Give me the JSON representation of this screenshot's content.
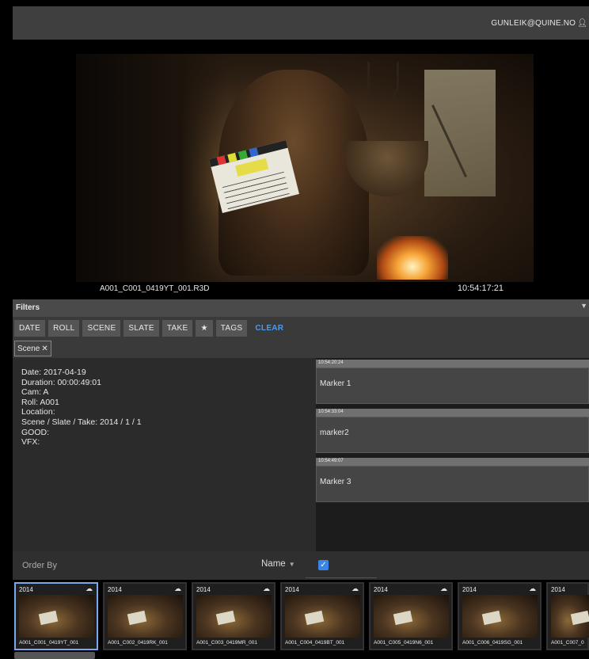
{
  "header": {
    "user": "GUNLEIK@QUINE.NO",
    "user_icon": "user-icon"
  },
  "player": {
    "clip_name": "A001_C001_0419YT_001.R3D",
    "timecode": "10:54:17:21"
  },
  "filters": {
    "title": "Filters",
    "buttons": [
      "DATE",
      "ROLL",
      "SCENE",
      "SLATE",
      "TAKE",
      "★",
      "TAGS"
    ],
    "clear_label": "CLEAR",
    "active_chip": "Scene",
    "chip_close": "✕"
  },
  "metadata": {
    "lines": [
      "Date: 2017-04-19",
      "Duration: 00:00:49:01",
      "Cam: A",
      "Roll: A001",
      "Location:",
      "Scene / Slate / Take: 2014 / 1 / 1",
      "GOOD:",
      "VFX:"
    ]
  },
  "markers": [
    {
      "time": "10:54:20:24",
      "label": "Marker 1"
    },
    {
      "time": "10:54:33:04",
      "label": "marker2"
    },
    {
      "time": "10:54:49:07",
      "label": "Marker 3"
    }
  ],
  "order": {
    "label": "Order By",
    "value": "Name",
    "checked": true
  },
  "thumbnails": [
    {
      "year": "2014",
      "name": "A001_C001_0419YT_001",
      "selected": true
    },
    {
      "year": "2014",
      "name": "A001_C002_0419RK_001",
      "selected": false
    },
    {
      "year": "2014",
      "name": "A001_C003_0419MR_001",
      "selected": false
    },
    {
      "year": "2014",
      "name": "A001_C004_0419BT_001",
      "selected": false
    },
    {
      "year": "2014",
      "name": "A001_C005_0419N6_001",
      "selected": false
    },
    {
      "year": "2014",
      "name": "A001_C006_0419SG_001",
      "selected": false
    },
    {
      "year": "2014",
      "name": "A001_C007_0",
      "selected": false
    }
  ],
  "colors": {
    "accent": "#3a86e8",
    "clear_link": "#4a9af0",
    "selected_border": "#7da7ea"
  }
}
